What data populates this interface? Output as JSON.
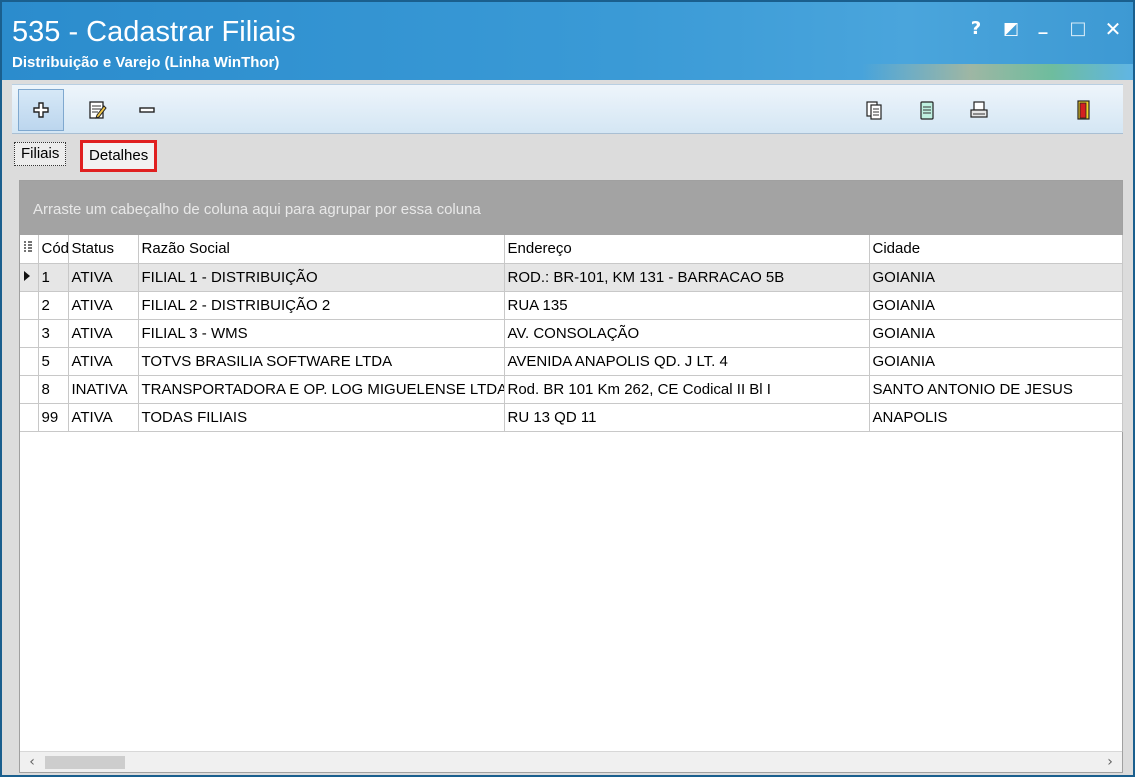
{
  "window": {
    "title": "535 - Cadastrar Filiais",
    "subtitle": "Distribuição e Varejo (Linha WinThor)",
    "controls": {
      "help": "?",
      "restore": "◩",
      "minimize": "_",
      "maximize": "□",
      "close": "✕"
    }
  },
  "toolbar": {
    "icons": [
      "add-icon",
      "edit-document-icon",
      "remove-icon",
      "copy-pages-icon",
      "notepad-icon",
      "print-icon",
      "exit-door-icon"
    ]
  },
  "tabs": [
    {
      "label": "Filiais",
      "selected": true
    },
    {
      "label": "Detalhes",
      "highlighted": true
    }
  ],
  "grid": {
    "group_hint": "Arraste um cabeçalho de coluna aqui para agrupar por essa coluna",
    "columns": [
      "Cód",
      "Status",
      "Razão Social",
      "Endereço",
      "Cidade"
    ],
    "rows": [
      {
        "cod": "1",
        "status": "ATIVA",
        "razao": "FILIAL 1 - DISTRIBUIÇÃO",
        "endereco": "ROD.: BR-101, KM 131 - BARRACAO 5B",
        "cidade": "GOIANIA",
        "current": true
      },
      {
        "cod": "2",
        "status": "ATIVA",
        "razao": "FILIAL 2 - DISTRIBUIÇÃO 2",
        "endereco": "RUA 135",
        "cidade": "GOIANIA"
      },
      {
        "cod": "3",
        "status": "ATIVA",
        "razao": "FILIAL 3 - WMS",
        "endereco": "AV. CONSOLAÇÃO",
        "cidade": "GOIANIA"
      },
      {
        "cod": "5",
        "status": "ATIVA",
        "razao": "TOTVS BRASILIA SOFTWARE LTDA",
        "endereco": "AVENIDA  ANAPOLIS QD. J LT. 4",
        "cidade": "GOIANIA"
      },
      {
        "cod": "8",
        "status": "INATIVA",
        "razao": "TRANSPORTADORA E OP. LOG MIGUELENSE LTDA",
        "endereco": "Rod. BR 101 Km 262, CE Codical II Bl I",
        "cidade": "SANTO ANTONIO DE JESUS"
      },
      {
        "cod": "99",
        "status": "ATIVA",
        "razao": "TODAS FILIAIS",
        "endereco": "RU 13 QD 11",
        "cidade": "ANAPOLIS"
      }
    ]
  },
  "scrollbar": {
    "left": "‹",
    "right": "›"
  }
}
